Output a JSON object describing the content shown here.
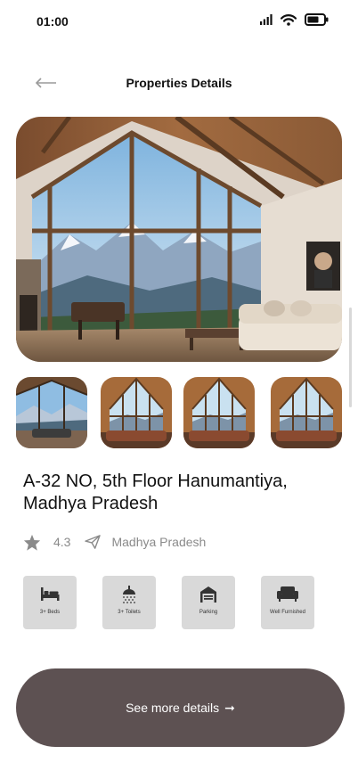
{
  "status_bar": {
    "time": "01:00"
  },
  "header": {
    "title": "Properties Details"
  },
  "property": {
    "title": "A-32 NO, 5th Floor Hanumantiya, Madhya Pradesh",
    "rating": "4.3",
    "location": "Madhya Pradesh"
  },
  "amenities": [
    {
      "label": "3+ Beds",
      "icon": "bed-icon"
    },
    {
      "label": "3+ Toilets",
      "icon": "shower-icon"
    },
    {
      "label": "Parking",
      "icon": "garage-icon"
    },
    {
      "label": "Well Furnished",
      "icon": "sofa-icon"
    }
  ],
  "cta": {
    "label": "See more details",
    "arrow": "➞"
  },
  "colors": {
    "cta_background": "#5d5152",
    "amenity_tile": "#d9d9d9",
    "muted_text": "#8a8a8a"
  }
}
